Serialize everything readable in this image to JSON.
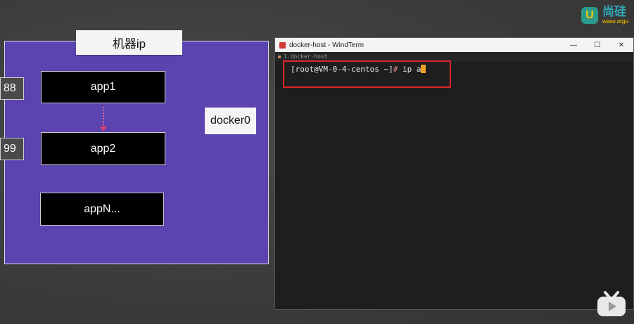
{
  "slide": {
    "machine_label": "机器ip",
    "ports": [
      "88",
      "99"
    ],
    "apps": [
      "app1",
      "app2",
      "appN..."
    ],
    "docker0_label": "docker0"
  },
  "terminal": {
    "window_title": "docker-host - WindTerm",
    "tab_label": "1.docker-host",
    "prompt": "[root@VM-0-4-centos ~]",
    "prompt_symbol": "#",
    "command": "ip a"
  },
  "logo": {
    "mark": "U",
    "name": "尚硅",
    "url": "www.atgu"
  },
  "colors": {
    "machine_bg": "#5b43b0",
    "highlight": "#e0242a",
    "cursor": "#f0a020"
  },
  "icons": [
    "app-icon",
    "minimize-icon",
    "maximize-icon",
    "close-icon",
    "tv-icon"
  ]
}
